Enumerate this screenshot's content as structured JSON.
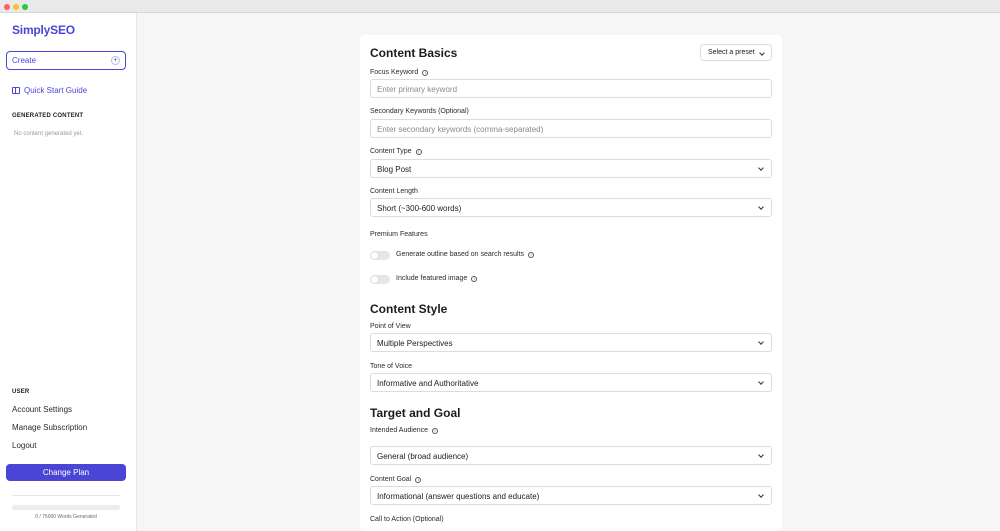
{
  "app": {
    "name": "SimplySEO"
  },
  "sidebar": {
    "create_label": "Create",
    "quick_start": "Quick Start Guide",
    "generated_title": "GENERATED CONTENT",
    "generated_empty": "No content generated yet.",
    "user_title": "USER",
    "nav": [
      "Account Settings",
      "Manage Subscription",
      "Logout"
    ],
    "change_plan": "Change Plan",
    "usage": {
      "text": "0 / 75000 Words Generated",
      "used": 0,
      "total": 75000
    }
  },
  "form": {
    "preset_label": "Select a preset",
    "basics": {
      "title": "Content Basics",
      "focus_keyword": {
        "label": "Focus Keyword",
        "placeholder": "Enter primary keyword"
      },
      "secondary_keywords": {
        "label": "Secondary Keywords (Optional)",
        "placeholder": "Enter secondary keywords (comma-separated)"
      },
      "content_type": {
        "label": "Content Type",
        "value": "Blog Post"
      },
      "content_length": {
        "label": "Content Length",
        "value": "Short (~300-600 words)"
      },
      "premium": {
        "title": "Premium Features",
        "outline_label": "Generate outline based on search results",
        "outline_on": false,
        "image_label": "Include featured image",
        "image_on": false
      }
    },
    "style": {
      "title": "Content Style",
      "pov": {
        "label": "Point of View",
        "value": "Multiple Perspectives"
      },
      "tone": {
        "label": "Tone of Voice",
        "value": "Informative and Authoritative"
      }
    },
    "target": {
      "title": "Target and Goal",
      "audience": {
        "label": "Intended Audience",
        "value": "General (broad audience)"
      },
      "goal": {
        "label": "Content Goal",
        "value": "Informational (answer questions and educate)"
      },
      "cta": {
        "label": "Call to Action (Optional)"
      }
    }
  },
  "colors": {
    "accent": "#4b45d6",
    "background": "#f6f6f7"
  }
}
